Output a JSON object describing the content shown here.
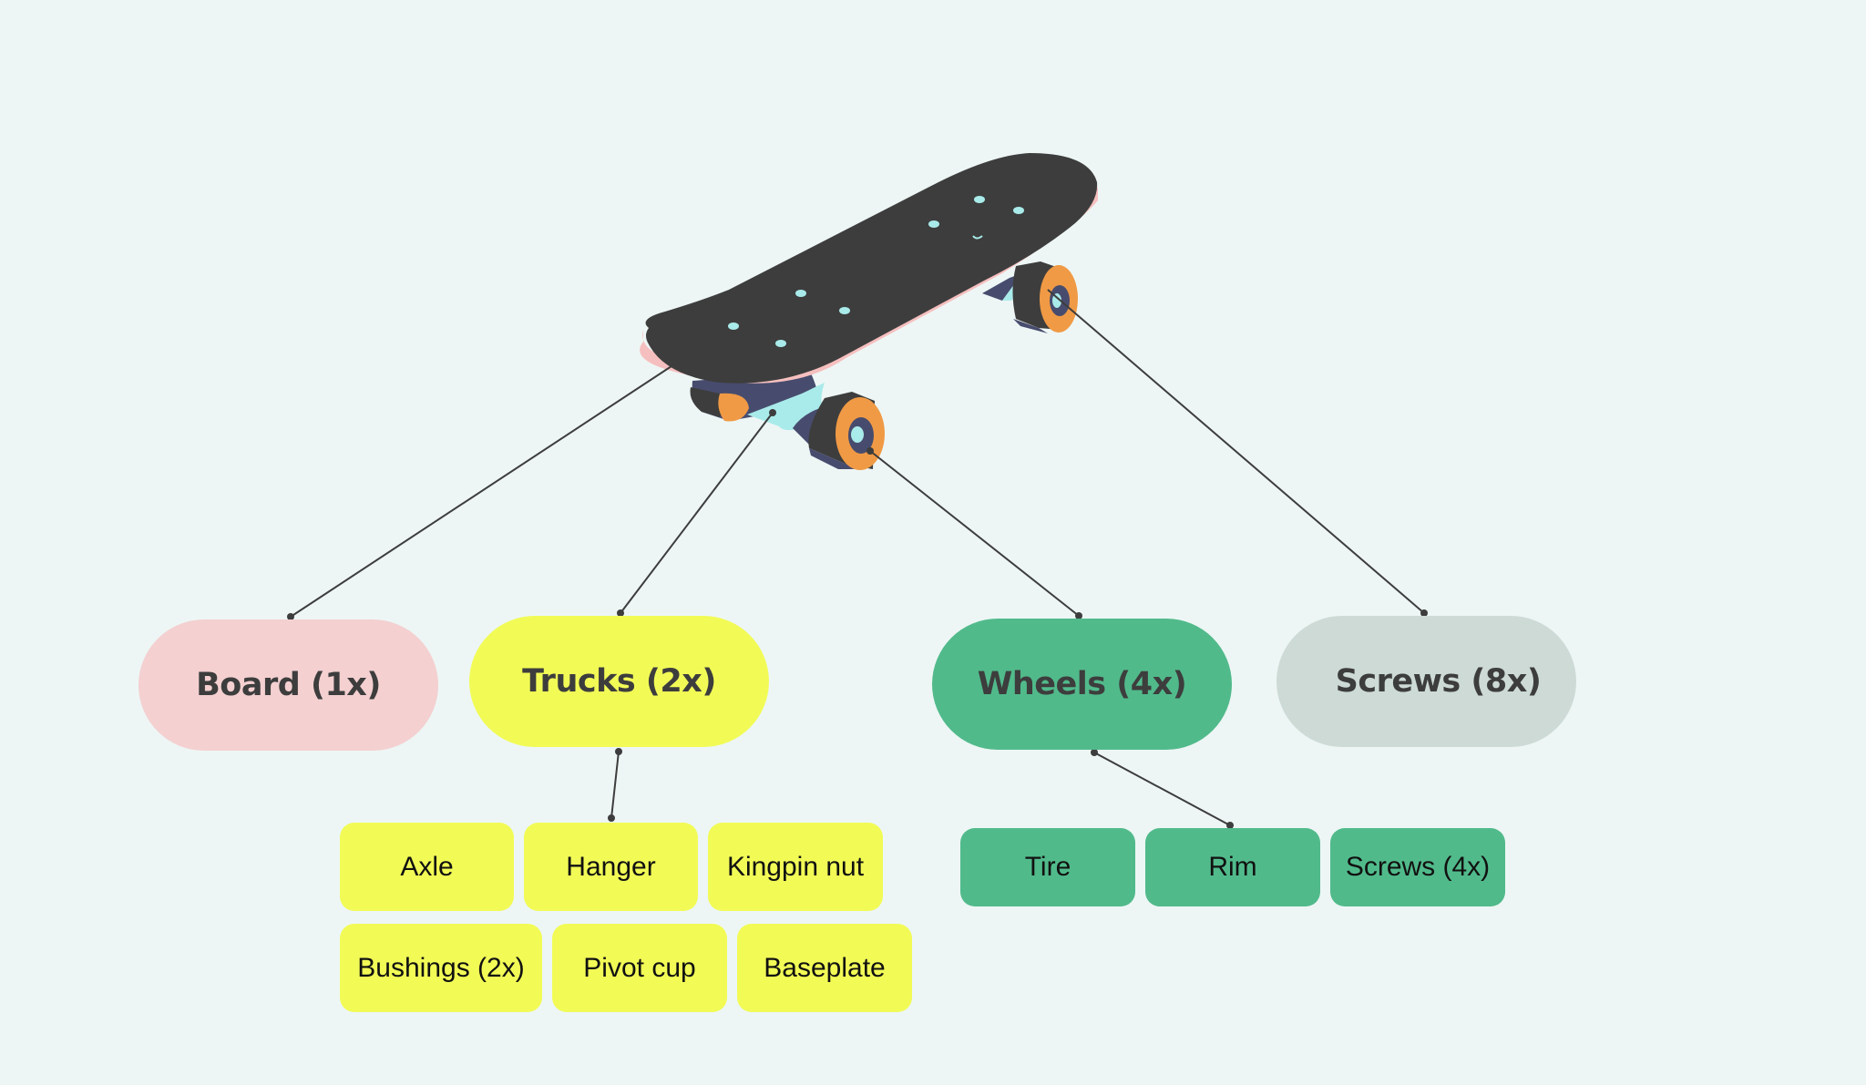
{
  "diagram": {
    "title_image": "skateboard-illustration",
    "colors": {
      "background": "#edf6f5",
      "board": "#f4d0d1",
      "trucks": "#f2fb56",
      "wheels": "#51ba8b",
      "screws": "#cddad6",
      "connector": "#3d3d3d",
      "deck": "#3d3d3d",
      "deck_edge": "#f6bfbf",
      "wheel_orange": "#f09a45",
      "truck_cyan": "#a9ebea",
      "truck_navy": "#474c6e"
    },
    "categories": [
      {
        "id": "board",
        "label": "Board (1x)"
      },
      {
        "id": "trucks",
        "label": "Trucks (2x)"
      },
      {
        "id": "wheels",
        "label": "Wheels (4x)"
      },
      {
        "id": "screws",
        "label": "Screws (8x)"
      }
    ],
    "trucks_parts": [
      {
        "label": "Axle"
      },
      {
        "label": "Hanger"
      },
      {
        "label": "Kingpin nut"
      },
      {
        "label": "Bushings (2x)"
      },
      {
        "label": "Pivot cup"
      },
      {
        "label": "Baseplate"
      }
    ],
    "wheels_parts": [
      {
        "label": "Tire"
      },
      {
        "label": "Rim"
      },
      {
        "label": "Screws (4x)"
      }
    ]
  }
}
